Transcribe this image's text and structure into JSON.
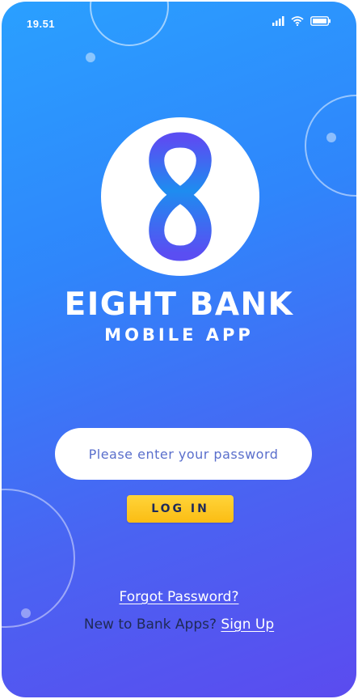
{
  "status_bar": {
    "time": "19.51",
    "icons": [
      "signal-icon",
      "wifi-icon",
      "battery-icon"
    ]
  },
  "brand": {
    "logo": "figure-eight-logo",
    "title": "EIGHT BANK",
    "subtitle": "MOBILE APP"
  },
  "login": {
    "password_placeholder": "Please enter your password",
    "login_label": "LOG IN",
    "forgot_label": "Forgot Password?",
    "signup_prompt": "New to Bank Apps?",
    "signup_label": "Sign Up"
  },
  "colors": {
    "gradient_top": "#2aa0ff",
    "gradient_bottom": "#5b4bef",
    "button": "#fbbd13",
    "logo_blue": "#1e8cf0",
    "logo_violet": "#5a4ef2"
  }
}
